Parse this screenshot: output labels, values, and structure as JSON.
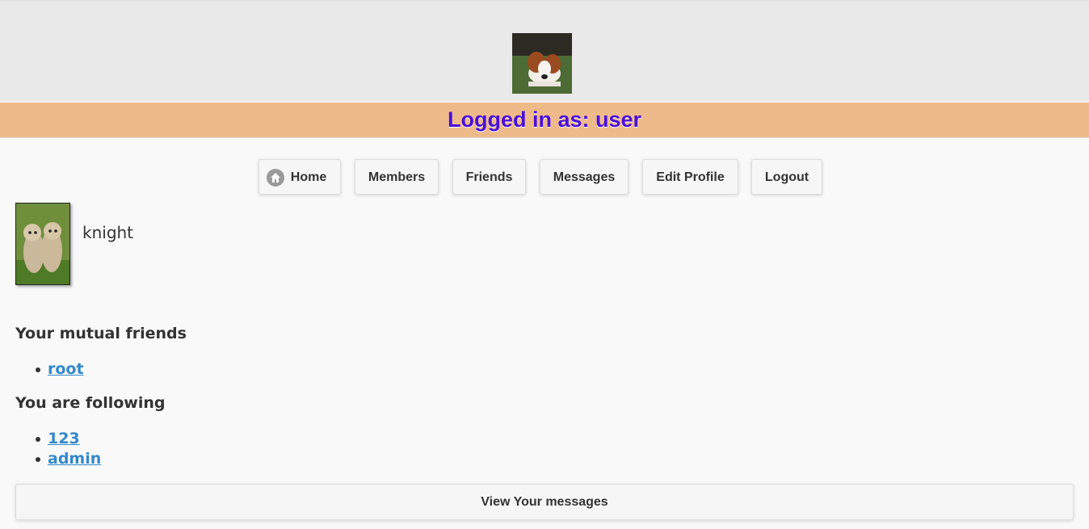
{
  "header": {
    "logo_icon": "puppy-logo-image"
  },
  "banner": {
    "text": "Logged in as: user",
    "color": "#4b0fd6",
    "background": "#efba8a"
  },
  "nav": {
    "items": [
      {
        "label": "Home",
        "icon": "home-icon"
      },
      {
        "label": "Members"
      },
      {
        "label": "Friends"
      },
      {
        "label": "Messages"
      },
      {
        "label": "Edit Profile"
      },
      {
        "label": "Logout"
      }
    ]
  },
  "profile": {
    "avatar_icon": "cheetah-cubs-avatar",
    "username": "knight"
  },
  "mutual_friends": {
    "title": "Your mutual friends",
    "items": [
      "root"
    ]
  },
  "following": {
    "title": "You are following",
    "items": [
      "123",
      "admin"
    ]
  },
  "actions": {
    "view_messages_label": "View Your messages"
  },
  "colors": {
    "link": "#3388cc",
    "header_bg": "#e9e9e9",
    "page_bg": "#f9f9f9"
  }
}
